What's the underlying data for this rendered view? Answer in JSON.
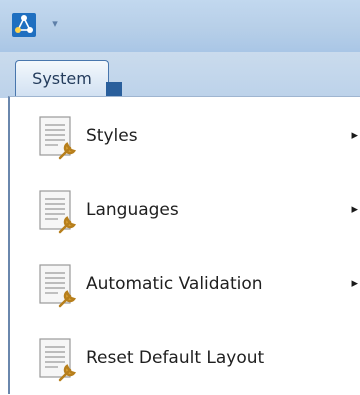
{
  "titlebar": {
    "app_icon": "graph-network-icon",
    "quick_access": {
      "icon": "dropdown-arrow-icon",
      "glyph": "▾"
    }
  },
  "ribbon": {
    "tabs": [
      {
        "label": "System",
        "selected": true
      }
    ]
  },
  "menu": {
    "items": [
      {
        "label": "Styles",
        "icon": "document-wrench-icon",
        "has_submenu": true,
        "arrow": "▸"
      },
      {
        "label": "Languages",
        "icon": "document-wrench-icon",
        "has_submenu": true,
        "arrow": "▸"
      },
      {
        "label": "Automatic Validation",
        "icon": "document-wrench-icon",
        "has_submenu": true,
        "arrow": "▸"
      },
      {
        "label": "Reset Default Layout",
        "icon": "document-wrench-icon",
        "has_submenu": false
      }
    ]
  },
  "colors": {
    "titlebar": "#b7cfe8",
    "tab_border": "#4876ad",
    "panel_border": "#6a87ad",
    "text": "#1f1f1f"
  }
}
